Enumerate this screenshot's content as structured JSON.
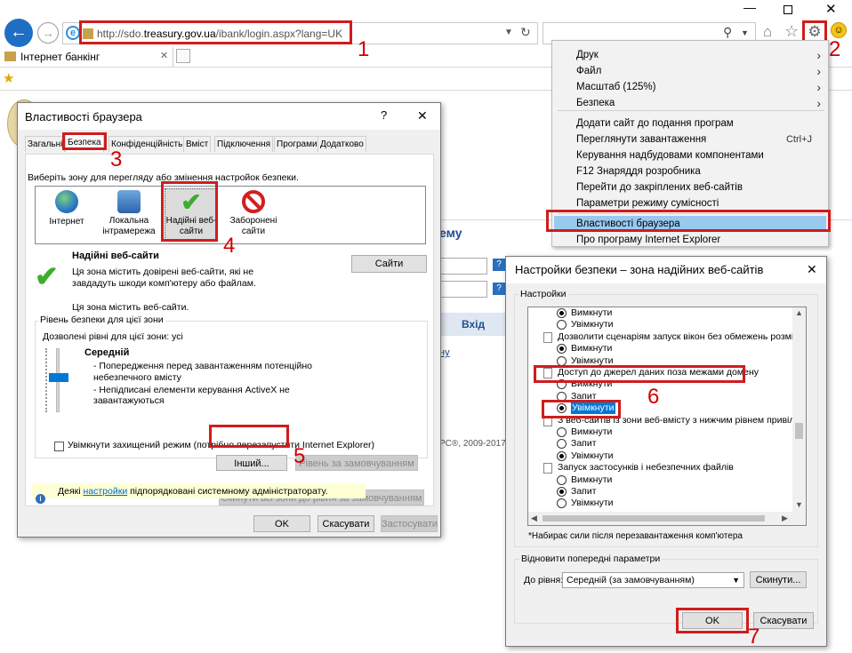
{
  "browser": {
    "address": "http://sdo.treasury.gov.ua/ibank/login.aspx?lang=UK",
    "address_parts": {
      "pre": "http://sdo.",
      "host": "treasury.gov.ua",
      "post": "/ibank/login.aspx?lang=UK"
    },
    "tab_title": "Інтернет банкінг"
  },
  "annotations": {
    "n1": "1",
    "n2": "2",
    "n3": "3",
    "n4": "4",
    "n5": "5",
    "n6": "6",
    "n7": "7"
  },
  "page_bg": {
    "heading_fragment": "ему",
    "login_button": "Вхід",
    "link_fragment": "ну",
    "footer": "PC®, 2009-2017"
  },
  "tools_menu": {
    "items": [
      {
        "label": "Друк",
        "shortcut": "",
        "arrow": true
      },
      {
        "label": "Файл",
        "shortcut": "",
        "arrow": true
      },
      {
        "label": "Масштаб (125%)",
        "shortcut": "",
        "arrow": true
      },
      {
        "label": "Безпека",
        "shortcut": "",
        "arrow": true
      },
      {
        "label": "Додати сайт до подання програм",
        "shortcut": "",
        "arrow": false
      },
      {
        "label": "Переглянути завантаження",
        "shortcut": "Ctrl+J",
        "arrow": false
      },
      {
        "label": "Керування надбудовами компонентами",
        "shortcut": "",
        "arrow": false
      },
      {
        "label": "F12 Знаряддя розробника",
        "shortcut": "",
        "arrow": false
      },
      {
        "label": "Перейти до закріплених веб-сайтів",
        "shortcut": "",
        "arrow": false
      },
      {
        "label": "Параметри режиму сумісності",
        "shortcut": "",
        "arrow": false
      },
      {
        "label": "Властивості браузера",
        "shortcut": "",
        "arrow": false
      },
      {
        "label": "Про програму Internet Explorer",
        "shortcut": "",
        "arrow": false
      }
    ]
  },
  "props_dialog": {
    "title": "Властивості браузера",
    "help": "?",
    "close": "✕",
    "tabs": [
      "Загальні",
      "Безпека",
      "Конфіденційність",
      "Вміст",
      "Підключення",
      "Програми",
      "Додатково"
    ],
    "zone_prompt": "Виберіть зону для перегляду або змінення настройок безпеки.",
    "zones": [
      {
        "label": "Інтернет"
      },
      {
        "label": "Локальна інтрамережа"
      },
      {
        "label": "Надійні веб-сайти"
      },
      {
        "label": "Заборонені сайти"
      }
    ],
    "zone_title": "Надійні веб-сайти",
    "zone_desc": "Ця зона містить довірені веб-сайти, які не завдадуть шкоди комп'ютеру або файлам.",
    "zone_has_sites": "Ця зона містить веб-сайти.",
    "sites_button": "Сайти",
    "level_group": "Рівень безпеки для цієї зони",
    "allowed_levels": "Дозволені рівні для цієї зони: усі",
    "level_name": "Середній",
    "level_bullets": [
      "- Попередження перед завантаженням потенційно небезпечного вмісту",
      "- Непідписані елементи керування ActiveX не завантажуються"
    ],
    "protected_mode": "Увімкнути захищений режим (потрібно перезапустити Internet Explorer)",
    "custom_button": "Інший...",
    "default_button": "Рівень за замовчуванням",
    "reset_all_button": "Скинути всі зони до рівня за замовчуванням",
    "info_pre": "Деякі ",
    "info_link": "настройки",
    "info_post": " підпорядковані системному адміністраторату.",
    "ok": "OK",
    "cancel": "Скасувати",
    "apply": "Застосувати"
  },
  "security_dialog": {
    "title": "Настройки безпеки – зона надійних веб-сайтів",
    "close": "✕",
    "settings_group": "Настройки",
    "rows": [
      {
        "kind": "radio",
        "label": "Вимкнути",
        "on": true
      },
      {
        "kind": "radio",
        "label": "Увімкнути",
        "on": false
      },
      {
        "kind": "doc",
        "label": "Дозволити сценаріям запуск вікон без обмежень розміру та",
        "on": false
      },
      {
        "kind": "radio",
        "label": "Вимкнути",
        "on": true
      },
      {
        "kind": "radio",
        "label": "Увімкнути",
        "on": false
      },
      {
        "kind": "doc",
        "label": "Доступ до джерел даних поза межами домену",
        "on": false
      },
      {
        "kind": "radio",
        "label": "Вимкнути",
        "on": false
      },
      {
        "kind": "radio",
        "label": "Запит",
        "on": false
      },
      {
        "kind": "radio",
        "label": "Увімкнути",
        "on": true
      },
      {
        "kind": "doc",
        "label": "З веб-сайтів із зони веб-вмісту з нижчим рівнем привілейов",
        "on": false
      },
      {
        "kind": "radio",
        "label": "Вимкнути",
        "on": false
      },
      {
        "kind": "radio",
        "label": "Запит",
        "on": false
      },
      {
        "kind": "radio",
        "label": "Увімкнути",
        "on": true
      },
      {
        "kind": "doc",
        "label": "Запуск застосунків і небезпечних файлів",
        "on": false
      },
      {
        "kind": "radio",
        "label": "Вимкнути",
        "on": false
      },
      {
        "kind": "radio",
        "label": "Запит",
        "on": true
      },
      {
        "kind": "radio",
        "label": "Увімкнути",
        "on": false
      }
    ],
    "restart_note": "*Набирає сили після перезавантаження комп'ютера",
    "restore_group": "Відновити попередні параметри",
    "to_level": "До рівня:",
    "level_value": "Середній (за замовчуванням)",
    "reset_button": "Скинути...",
    "ok": "OK",
    "cancel": "Скасувати"
  },
  "colors": {
    "accent": "#0078d7",
    "highlight": "#99c9ef",
    "annotation": "#d01c1c",
    "link": "#0066cc"
  }
}
